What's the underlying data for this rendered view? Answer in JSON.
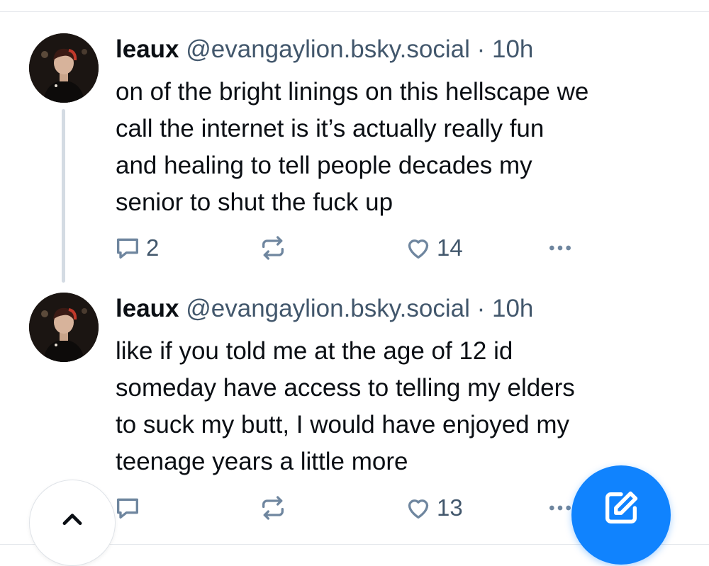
{
  "colors": {
    "accent": "#1083fe",
    "text": "#0b0f14",
    "secondary_text": "#42576c",
    "icon": "#6f869f",
    "thread_line": "#d4dbe3"
  },
  "posts": [
    {
      "author": "leaux",
      "handle": "@evangaylion.bsky.social",
      "separator": "·",
      "time": "10h",
      "text": "on of the bright linings on this hellscape we\ncall the internet is it’s actually really fun\nand healing to tell people decades my\nsenior to shut the fuck up",
      "reply_count": "2",
      "repost_count": "",
      "like_count": "14",
      "icons": {
        "reply": "reply-icon",
        "repost": "repost-icon",
        "like": "heart-icon",
        "more": "more-icon"
      }
    },
    {
      "author": "leaux",
      "handle": "@evangaylion.bsky.social",
      "separator": "·",
      "time": "10h",
      "text": "like if you told me at the age of 12 id\nsomeday have access to telling my elders\nto suck my butt, I would have enjoyed my\nteenage years a little more",
      "reply_count": "",
      "repost_count": "",
      "like_count": "13",
      "icons": {
        "reply": "reply-icon",
        "repost": "repost-icon",
        "like": "heart-icon",
        "more": "more-icon"
      }
    }
  ],
  "floating": {
    "scroll_top_icon": "chevron-up-icon",
    "compose_icon": "compose-icon"
  }
}
